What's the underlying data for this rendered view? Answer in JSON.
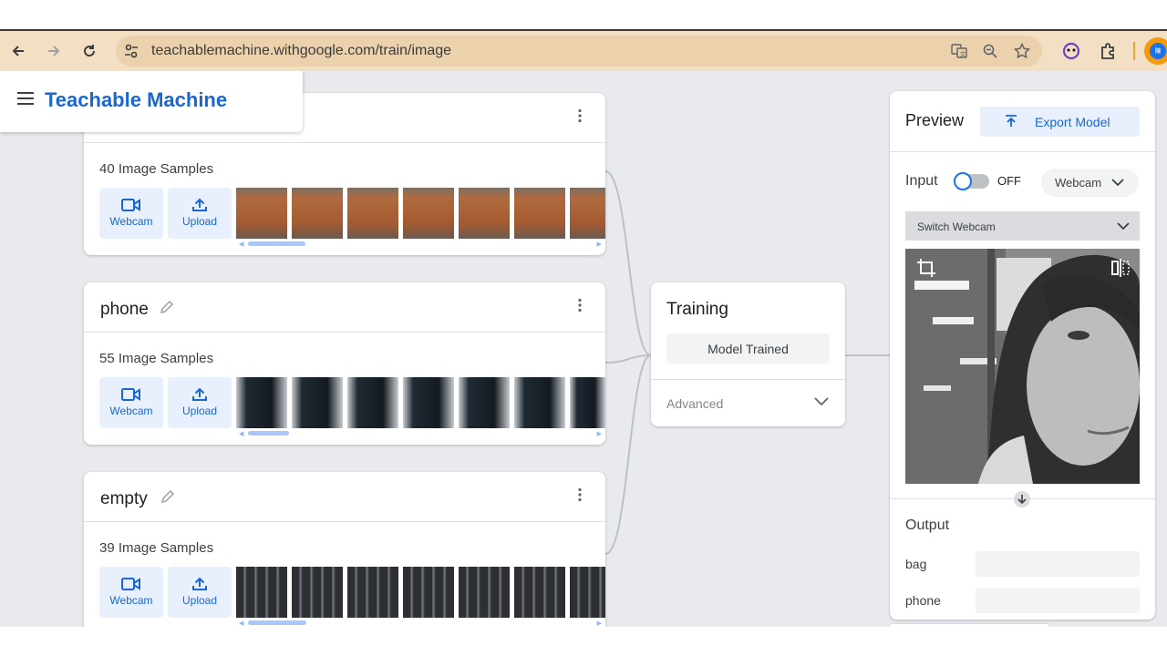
{
  "browser": {
    "url": "teachablemachine.withgoogle.com/train/image",
    "profile_initial": "陳"
  },
  "app": {
    "brand": "Teachable Machine"
  },
  "classes": [
    {
      "name": "",
      "sample_count": "40 Image Samples",
      "webcam_label": "Webcam",
      "upload_label": "Upload"
    },
    {
      "name": "phone",
      "sample_count": "55 Image Samples",
      "webcam_label": "Webcam",
      "upload_label": "Upload"
    },
    {
      "name": "empty",
      "sample_count": "39 Image Samples",
      "webcam_label": "Webcam",
      "upload_label": "Upload"
    }
  ],
  "training": {
    "title": "Training",
    "button": "Model Trained",
    "advanced": "Advanced"
  },
  "preview": {
    "title": "Preview",
    "export": "Export Model",
    "input_label": "Input",
    "toggle_state": "OFF",
    "source": "Webcam",
    "switch_webcam": "Switch Webcam",
    "output_label": "Output",
    "outputs": [
      {
        "label": "bag"
      },
      {
        "label": "phone"
      }
    ]
  },
  "colors": {
    "accent": "#1967d2",
    "browser_bar": "#f3e0c4",
    "page_bg": "#e8eaed"
  }
}
